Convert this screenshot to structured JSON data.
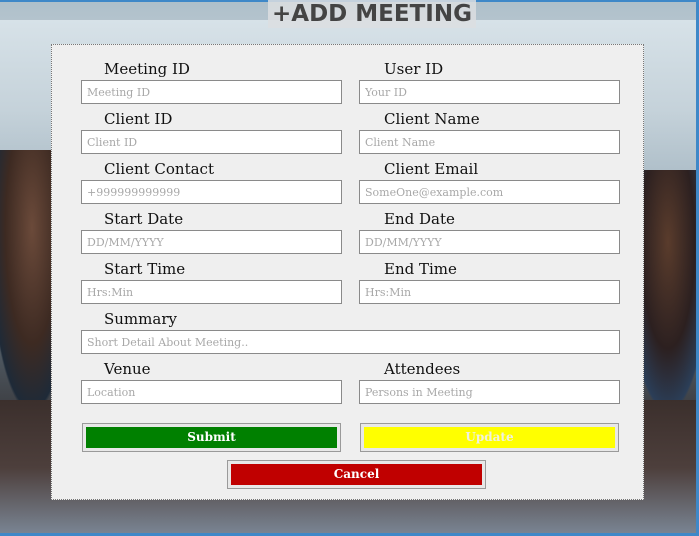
{
  "page": {
    "title": "+ADD MEETING"
  },
  "form": {
    "meeting_id": {
      "label": "Meeting ID",
      "placeholder": "Meeting ID"
    },
    "user_id": {
      "label": "User ID",
      "placeholder": "Your ID"
    },
    "client_id": {
      "label": "Client ID",
      "placeholder": "Client ID"
    },
    "client_name": {
      "label": "Client Name",
      "placeholder": "Client Name"
    },
    "client_contact": {
      "label": "Client Contact",
      "placeholder": "+999999999999"
    },
    "client_email": {
      "label": "Client Email",
      "placeholder": "SomeOne@example.com"
    },
    "start_date": {
      "label": "Start Date",
      "placeholder": "DD/MM/YYYY"
    },
    "end_date": {
      "label": "End Date",
      "placeholder": "DD/MM/YYYY"
    },
    "start_time": {
      "label": "Start Time",
      "placeholder": "Hrs:Min"
    },
    "end_time": {
      "label": "End Time",
      "placeholder": "Hrs:Min"
    },
    "summary": {
      "label": "Summary",
      "placeholder": "Short Detail About Meeting.."
    },
    "venue": {
      "label": "Venue",
      "placeholder": "Location"
    },
    "attendees": {
      "label": "Attendees",
      "placeholder": "Persons in Meeting"
    }
  },
  "buttons": {
    "submit": {
      "label": "Submit",
      "color": "#008000"
    },
    "update": {
      "label": "Update",
      "color": "#ffff00"
    },
    "cancel": {
      "label": "Cancel",
      "color": "#c00000"
    }
  }
}
